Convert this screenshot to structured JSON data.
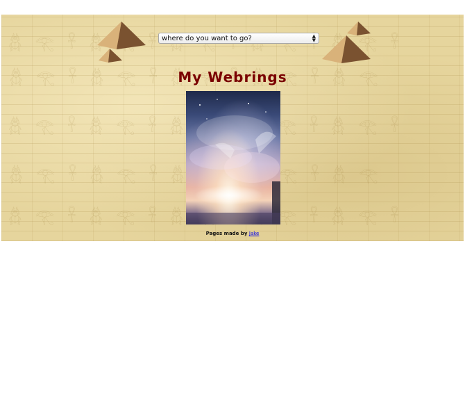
{
  "navigation": {
    "select_value": "where do you want to go?"
  },
  "page": {
    "title": "My Webrings"
  },
  "footer": {
    "prefix": "Pages made by",
    "author_link": "Jake"
  },
  "colors": {
    "title": "#7a0000",
    "background": "#e6d59d",
    "link": "#0000ee"
  },
  "icons": {
    "pyramid_left_large": "pyramid-icon",
    "pyramid_left_small": "pyramid-icon",
    "pyramid_right_large": "pyramid-icon",
    "pyramid_right_small": "pyramid-icon"
  }
}
